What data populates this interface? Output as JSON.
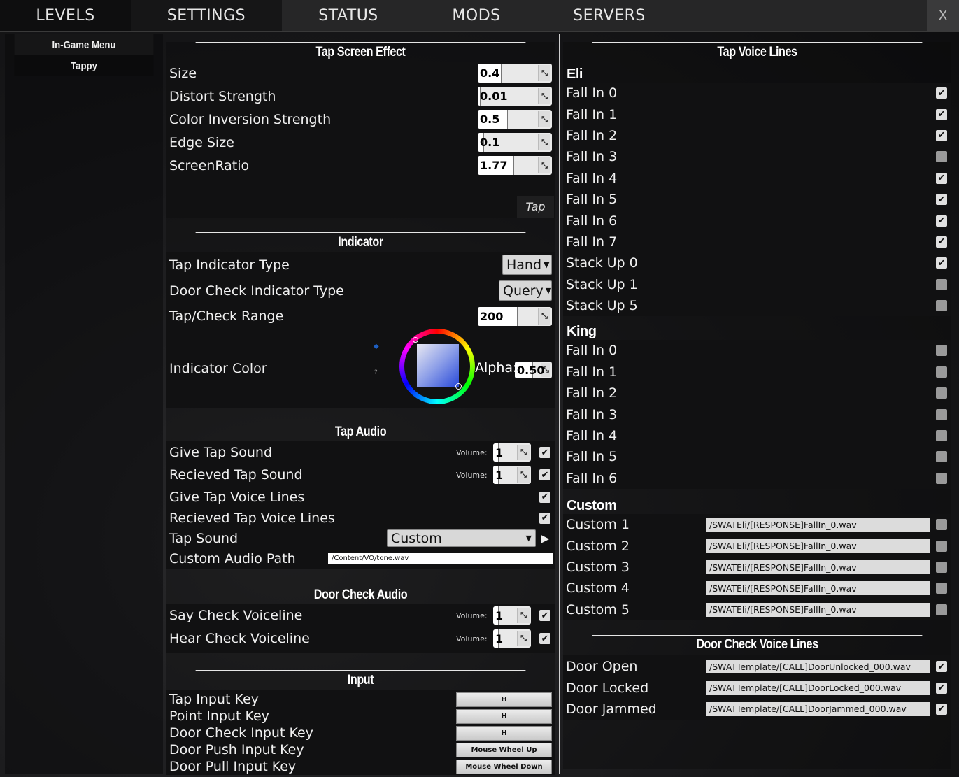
{
  "tabs": {
    "levels": "LEVELS",
    "settings": "SETTINGS",
    "status": "STATUS",
    "mods": "MODS",
    "servers": "SERVERS",
    "close": "X"
  },
  "sidebar": {
    "items": [
      "In-Game Menu",
      "Tappy"
    ]
  },
  "tap_screen_effect": {
    "title": "Tap Screen Effect",
    "rows": [
      {
        "label": "Size",
        "value": "0.4",
        "fraction": 0.4
      },
      {
        "label": "Distort Strength",
        "value": "0.01",
        "fraction": 0.01
      },
      {
        "label": "Color Inversion Strength",
        "value": "0.5",
        "fraction": 0.5
      },
      {
        "label": "Edge Size",
        "value": "0.1",
        "fraction": 0.1
      },
      {
        "label": "ScreenRatio",
        "value": "1.77",
        "fraction": 0.6
      }
    ],
    "tap_button": "Tap"
  },
  "indicator": {
    "title": "Indicator",
    "tap_indicator_type": {
      "label": "Tap Indicator Type",
      "value": "Hand"
    },
    "door_check_indicator_type": {
      "label": "Door Check Indicator Type",
      "value": "Query"
    },
    "range": {
      "label": "Tap/Check Range",
      "value": "200",
      "fraction": 0.66
    },
    "color": {
      "label": "Indicator Color",
      "alpha_label": "Alpha:",
      "alpha_value": "0.50",
      "hint": "?",
      "color": "#5a78e6"
    }
  },
  "tap_audio": {
    "title": "Tap Audio",
    "volume_label": "Volume:",
    "give_tap_sound": {
      "label": "Give Tap Sound",
      "volume": "1",
      "checked": true
    },
    "recieved_tap_sound": {
      "label": "Recieved Tap Sound",
      "volume": "1",
      "checked": true
    },
    "give_voice_lines": {
      "label": "Give Tap Voice Lines",
      "checked": true
    },
    "recieved_voice_lines": {
      "label": "Recieved Tap Voice Lines",
      "checked": true
    },
    "tap_sound": {
      "label": "Tap Sound",
      "value": "Custom"
    },
    "custom_path": {
      "label": "Custom Audio Path",
      "value": "/Content/VO/tone.wav"
    }
  },
  "door_check_audio": {
    "title": "Door Check Audio",
    "volume_label": "Volume:",
    "say": {
      "label": "Say Check Voiceline",
      "volume": "1",
      "checked": true
    },
    "hear": {
      "label": "Hear Check Voiceline",
      "volume": "1",
      "checked": true
    }
  },
  "input": {
    "title": "Input",
    "rows": [
      {
        "label": "Tap Input Key",
        "key": "H"
      },
      {
        "label": "Point Input Key",
        "key": "H"
      },
      {
        "label": "Door Check Input Key",
        "key": "H"
      },
      {
        "label": "Door Push Input Key",
        "key": "Mouse Wheel Up"
      },
      {
        "label": "Door Pull Input Key",
        "key": "Mouse Wheel Down"
      }
    ]
  },
  "tap_voice_lines": {
    "title": "Tap Voice Lines",
    "eli": {
      "name": "Eli",
      "items": [
        {
          "label": "Fall In 0",
          "checked": true
        },
        {
          "label": "Fall In 1",
          "checked": true
        },
        {
          "label": "Fall In 2",
          "checked": true
        },
        {
          "label": "Fall In 3",
          "checked": false
        },
        {
          "label": "Fall In 4",
          "checked": true
        },
        {
          "label": "Fall In 5",
          "checked": true
        },
        {
          "label": "Fall In 6",
          "checked": true
        },
        {
          "label": "Fall In 7",
          "checked": true
        },
        {
          "label": "Stack Up 0",
          "checked": true
        },
        {
          "label": "Stack Up 1",
          "checked": false
        },
        {
          "label": "Stack Up 5",
          "checked": false
        }
      ]
    },
    "king": {
      "name": "King",
      "items": [
        {
          "label": "Fall In 0",
          "checked": false
        },
        {
          "label": "Fall In 1",
          "checked": false
        },
        {
          "label": "Fall In 2",
          "checked": false
        },
        {
          "label": "Fall In 3",
          "checked": false
        },
        {
          "label": "Fall In 4",
          "checked": false
        },
        {
          "label": "Fall In 5",
          "checked": false
        },
        {
          "label": "Fall In 6",
          "checked": false
        }
      ]
    },
    "custom": {
      "name": "Custom",
      "items": [
        {
          "label": "Custom 1",
          "path": "/SWATEli/[RESPONSE]FallIn_0.wav",
          "checked": false
        },
        {
          "label": "Custom 2",
          "path": "/SWATEli/[RESPONSE]FallIn_0.wav",
          "checked": false
        },
        {
          "label": "Custom 3",
          "path": "/SWATEli/[RESPONSE]FallIn_0.wav",
          "checked": false
        },
        {
          "label": "Custom 4",
          "path": "/SWATEli/[RESPONSE]FallIn_0.wav",
          "checked": false
        },
        {
          "label": "Custom 5",
          "path": "/SWATEli/[RESPONSE]FallIn_0.wav",
          "checked": false
        }
      ]
    }
  },
  "door_check_voice_lines": {
    "title": "Door Check Voice Lines",
    "items": [
      {
        "label": "Door Open",
        "path": "/SWATTemplate/[CALL]DoorUnlocked_000.wav",
        "checked": true
      },
      {
        "label": "Door Locked",
        "path": "/SWATTemplate/[CALL]DoorLocked_000.wav",
        "checked": true
      },
      {
        "label": "Door Jammed",
        "path": "/SWATTemplate/[CALL]DoorJammed_000.wav",
        "checked": true
      }
    ]
  }
}
